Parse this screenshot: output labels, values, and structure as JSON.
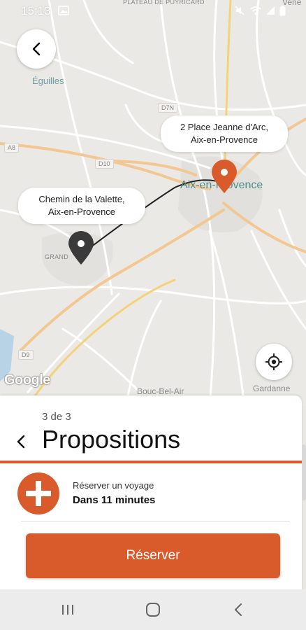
{
  "status_bar": {
    "time": "15:13"
  },
  "map": {
    "place_labels": {
      "plateau": "PLATEAU DE PUYRICARD",
      "venelles": "Vene",
      "equilles": "Éguilles",
      "city": "Aix-en-Provence",
      "grand": "GRAND",
      "bouc_bel_air": "Bouc-Bel-Air",
      "gardanne": "Gardanne"
    },
    "road_badges": {
      "d7n": "D7N",
      "a8": "A8",
      "d10": "D10",
      "d9": "D9"
    },
    "attribution": "Google"
  },
  "route": {
    "destination": {
      "line1": "2 Place Jeanne d'Arc,",
      "line2": "Aix-en-Provence"
    },
    "origin": {
      "line1": "Chemin de la Valette,",
      "line2": "Aix-en-Provence"
    }
  },
  "sheet": {
    "step": "3 de 3",
    "title": "Propositions",
    "proposal": {
      "label": "Réserver un voyage",
      "time": "Dans 11 minutes"
    },
    "reserve_button": "Réserver"
  },
  "colors": {
    "accent": "#d95a2b",
    "origin_pin": "#3a3a3a",
    "city_label": "#4e8f8a"
  },
  "icons": {
    "back": "chevron-left-icon",
    "locate": "my-location-icon",
    "plus": "plus-icon",
    "nav_recent": "recent-apps-icon",
    "nav_home": "home-icon",
    "nav_back": "nav-back-icon"
  }
}
